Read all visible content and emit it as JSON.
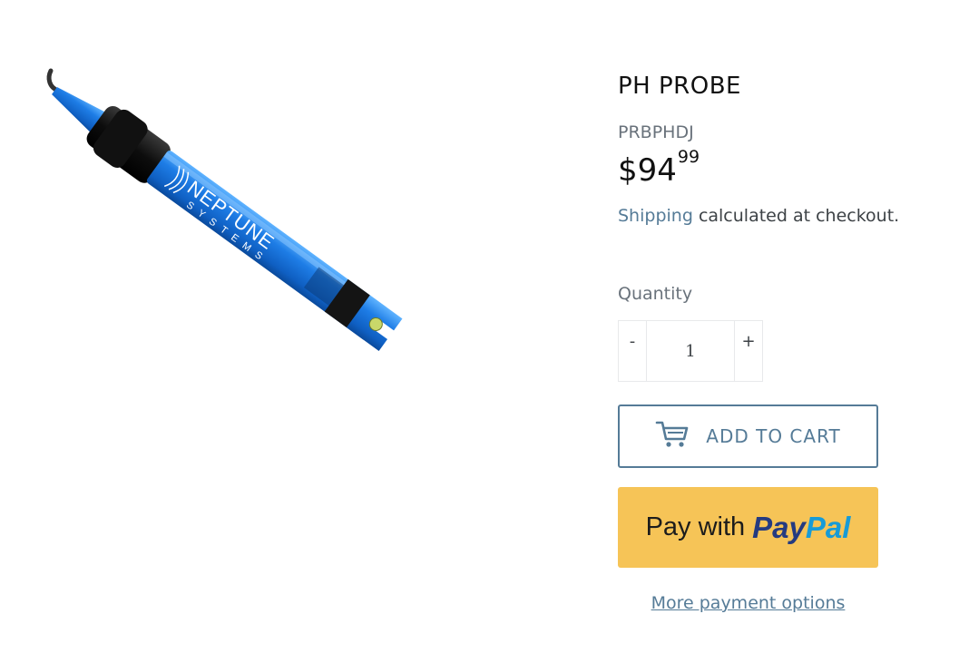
{
  "product": {
    "title": "PH PROBE",
    "sku": "PRBPHDJ",
    "price_main": "$94",
    "price_cents": "99",
    "image_brand_line1": "NEPTUNE",
    "image_brand_line2": "SYSTEMS"
  },
  "shipping": {
    "link_text": "Shipping",
    "suffix": "calculated at checkout."
  },
  "quantity": {
    "label": "Quantity",
    "minus": "-",
    "plus": "+",
    "value": "1"
  },
  "buttons": {
    "add_to_cart": "ADD TO CART",
    "paypal_prefix": "Pay with",
    "paypal_brand_part1": "Pay",
    "paypal_brand_part2": "Pal",
    "more_payment_options": "More payment options"
  },
  "colors": {
    "accent": "#557b97",
    "paypal_bg": "#f6c457",
    "paypal_dark": "#253b80",
    "paypal_light": "#179bd7",
    "probe_blue": "#1e7de6"
  },
  "icons": {
    "cart": "cart-icon"
  }
}
